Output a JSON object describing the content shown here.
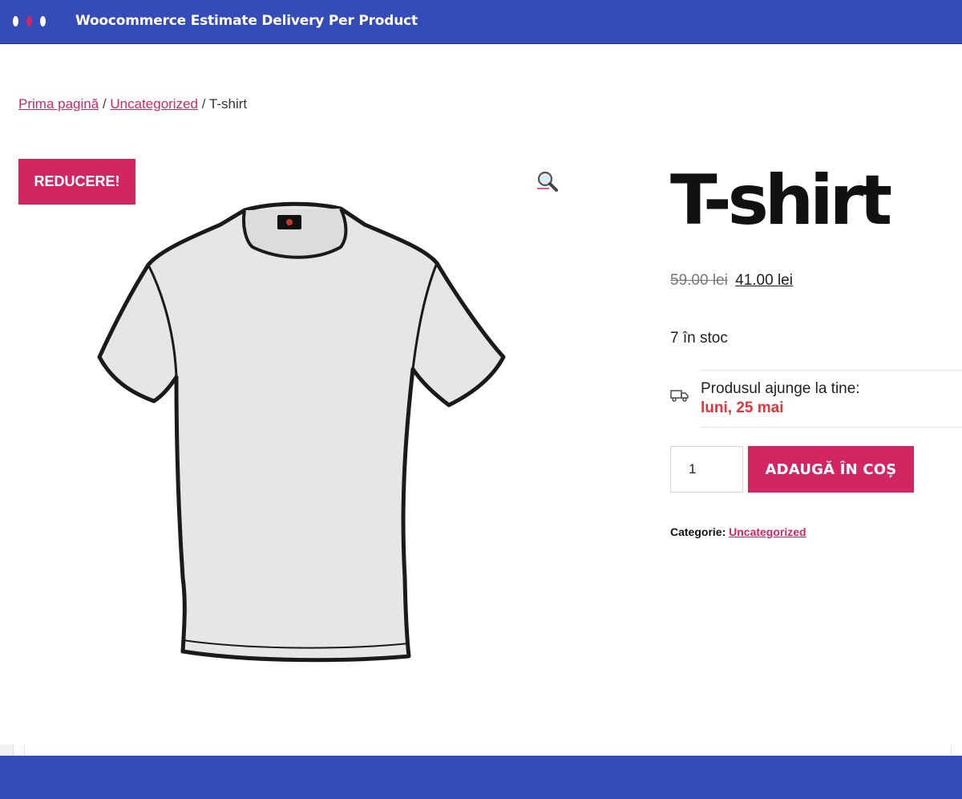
{
  "window": {
    "title": "Woocommerce Estimate Delivery Per Product",
    "dot_colors": [
      "#ffffff",
      "#d22662",
      "#ffffff"
    ],
    "bar_color": "#354cb8"
  },
  "breadcrumb": {
    "home": "Prima pagină",
    "separator": "/",
    "category": "Uncategorized",
    "current": "T-shirt"
  },
  "product": {
    "sale_badge": "REDUCERE!",
    "title": "T-shirt",
    "price_old": "59.00 lei",
    "price_new": "41.00 lei",
    "stock": "7 în stoc",
    "image_icon": "t-shirt-image",
    "zoom_icon": "magnifier-icon"
  },
  "delivery": {
    "label": "Produsul ajunge la tine:",
    "date": "luni, 25 mai",
    "icon": "truck-icon"
  },
  "cart": {
    "quantity": "1",
    "button_label": "ADAUGĂ ÎN COȘ"
  },
  "meta": {
    "category_label": "Categorie:",
    "category_value": "Uncategorized"
  },
  "colors": {
    "accent": "#d22662",
    "delivery_date": "#e2343b",
    "frame": "#354cb8"
  }
}
